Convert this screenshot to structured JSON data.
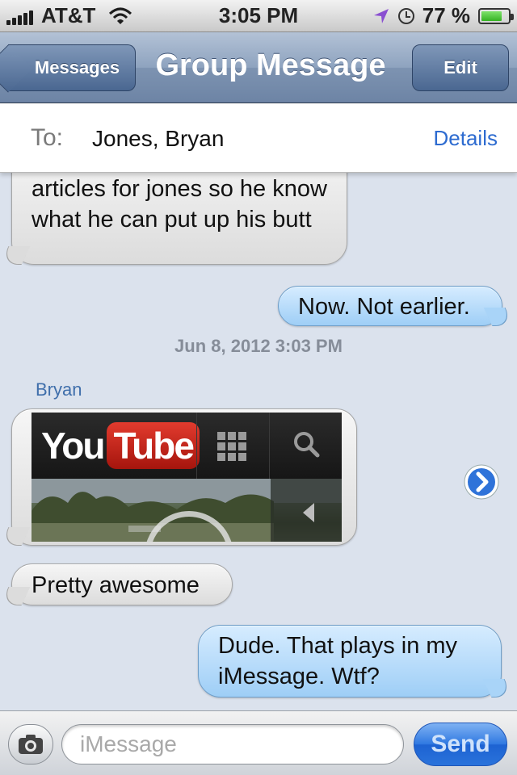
{
  "status_bar": {
    "carrier": "AT&T",
    "time": "3:05 PM",
    "battery": "77 %",
    "battery_level": 0.77,
    "icons": [
      "signal-icon",
      "wifi-icon",
      "location-icon",
      "alarm-clock-icon",
      "battery-icon"
    ]
  },
  "nav": {
    "back_label": "Messages",
    "title": "Group Message",
    "edit_label": "Edit"
  },
  "recipients": {
    "to_label": "To:",
    "names": "Jones, Bryan",
    "details_label": "Details"
  },
  "thread": {
    "messages": [
      {
        "from": "them",
        "text": "articles for jones so he know what he can put up his butt"
      },
      {
        "from": "me",
        "text": "Now. Not earlier."
      }
    ],
    "timestamp": "Jun 8, 2012 3:03 PM",
    "sender_name": "Bryan",
    "youtube_card": {
      "logo_you": "You",
      "logo_tube": "Tube"
    },
    "later_messages": [
      {
        "from": "them",
        "text": "Pretty awesome"
      },
      {
        "from": "me",
        "text": "Dude. That plays in my iMessage. Wtf?"
      }
    ]
  },
  "input": {
    "placeholder": "iMessage",
    "send_label": "Send"
  },
  "colors": {
    "background": "#dbe2ed",
    "link": "#2d6bd0",
    "sender": "#406fab",
    "send_button": "#2a73db"
  }
}
